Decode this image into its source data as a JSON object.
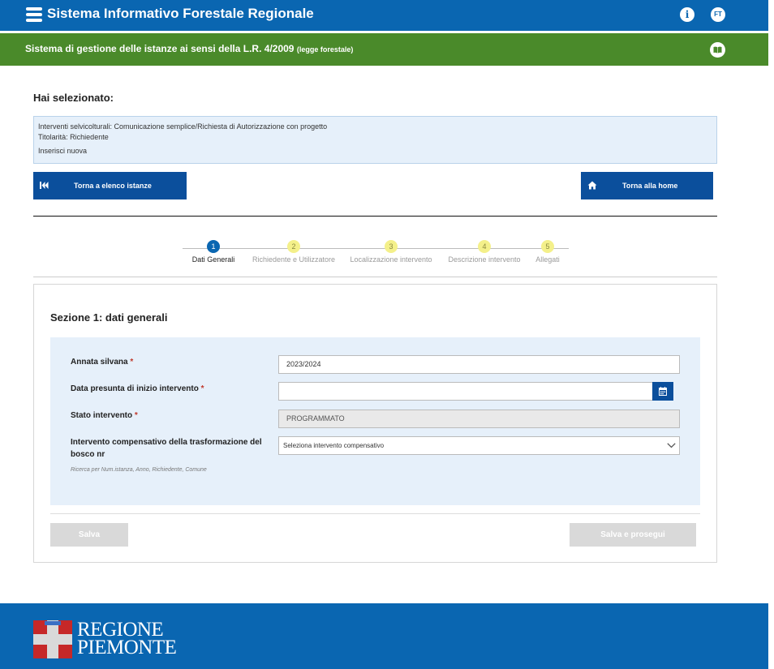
{
  "header": {
    "app_title": "Sistema Informativo Forestale Regionale",
    "info_label": "i",
    "user_initials": "FT",
    "accent_color": "#0a66b1"
  },
  "subheader": {
    "title": "Sistema di gestione delle istanze ai sensi della L.R. 4/2009",
    "title_small": "(legge forestale)",
    "color": "#4a8a2a"
  },
  "selection": {
    "heading": "Hai selezionato:",
    "line1": "Interventi selvicolturali: Comunicazione semplice/Richiesta di Autorizzazione con progetto",
    "line2": "Titolarità: Richiedente",
    "line3": "Inserisci nuova"
  },
  "nav": {
    "back_label": "Torna a elenco istanze",
    "home_label": "Torna alla home"
  },
  "steps": [
    {
      "num": "1",
      "label": "Dati Generali",
      "active": true
    },
    {
      "num": "2",
      "label": "Richiedente e Utilizzatore",
      "active": false
    },
    {
      "num": "3",
      "label": "Localizzazione intervento",
      "active": false
    },
    {
      "num": "4",
      "label": "Descrizione intervento",
      "active": false
    },
    {
      "num": "5",
      "label": "Allegati",
      "active": false
    }
  ],
  "form": {
    "section_title": "Sezione 1: dati generali",
    "annata_label": "Annata silvana",
    "annata_value": "2023/2024",
    "data_label": "Data presunta di inizio intervento",
    "data_value": "",
    "stato_label": "Stato intervento",
    "stato_value": "PROGRAMMATO",
    "comp_label": "Intervento compensativo della trasformazione del bosco nr",
    "comp_value": "Seleziona intervento compensativo",
    "hint": "Ricerca per Num.istanza, Anno, Richiedente, Comune",
    "required_mark": "*"
  },
  "actions": {
    "save_label": "Salva",
    "save_next_label": "Salva e prosegui"
  },
  "footer": {
    "logo_line1": "REGIONE",
    "logo_line2": "PIEMONTE"
  }
}
